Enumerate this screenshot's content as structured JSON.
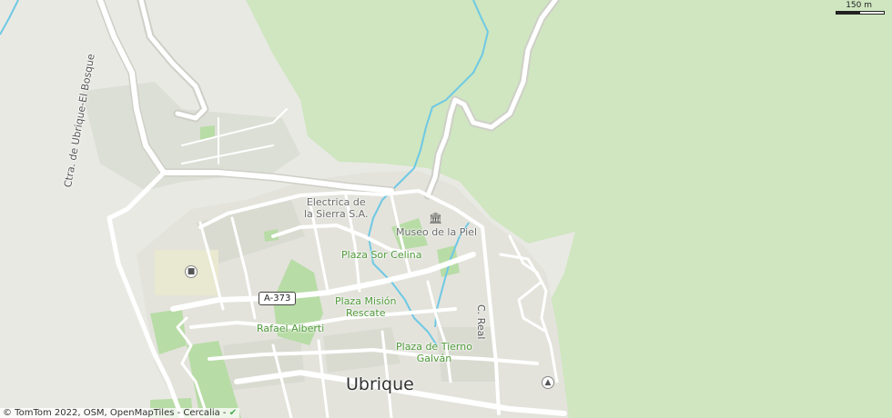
{
  "map": {
    "colors": {
      "forest": "#cfe6c0",
      "urban": "#e3e3dc",
      "residential": "#d8dbd0",
      "park": "#b8dca6",
      "water": "#6ec9e4",
      "road": "#ffffff",
      "road_casing": "#c9c9c2"
    },
    "street_labels": {
      "ctra_bosque": "Ctra. de Ubrique-El Bosque",
      "c_real": "C. Real",
      "a373": "A-373"
    },
    "poi_labels": {
      "electrica_line1": "Electrica de",
      "electrica_line2": "la Sierra S.A.",
      "museo": "Museo de la Piel"
    },
    "park_labels": {
      "sor_celina": "Plaza Sor Celina",
      "mision_line1": "Plaza Misión",
      "mision_line2": "Rescate",
      "rafael": "Rafael Alberti",
      "tierno_line1": "Plaza de Tierno",
      "tierno_line2": "Galván"
    },
    "city_label": "Ubrique",
    "scale_label": "150 m",
    "attribution": "© TomTom 2022, OSM, OpenMapTiles - Cercalia -"
  }
}
